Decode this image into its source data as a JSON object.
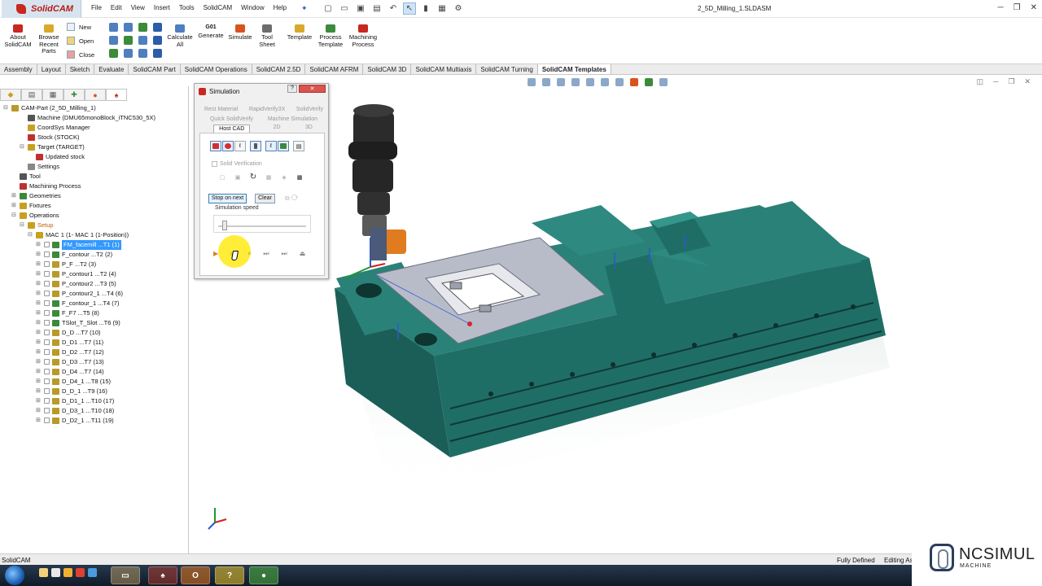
{
  "app": {
    "logo_text": "SolidCAM",
    "document_title": "2_5D_Milling_1.SLDASM"
  },
  "menu": [
    "File",
    "Edit",
    "View",
    "Insert",
    "Tools",
    "SolidCAM",
    "Window",
    "Help"
  ],
  "ribbon": {
    "about": "About\nSolidCAM",
    "browse": "Browse\nRecent\nParts",
    "new": "New",
    "open": "Open",
    "close": "Close",
    "calculate": "Calculate\nAll",
    "generate_code": "G01",
    "generate": "Generate",
    "simulate": "Simulate",
    "tool_sheet": "Tool\nSheet",
    "template": "Template",
    "process_template": "Process\nTemplate",
    "machining_process": "Machining\nProcess"
  },
  "tabs": [
    "Assembly",
    "Layout",
    "Sketch",
    "Evaluate",
    "SolidCAM Part",
    "SolidCAM Operations",
    "SolidCAM 2.5D",
    "SolidCAM AFRM",
    "SolidCAM 3D",
    "SolidCAM Multiaxis",
    "SolidCAM Turning",
    "SolidCAM Templates"
  ],
  "active_tab": "SolidCAM Templates",
  "tree": [
    {
      "label": "CAM-Part (2_5D_Milling_1)",
      "indent": 0,
      "twisty": "⊟",
      "icon": "#b89a2a"
    },
    {
      "label": "Machine (DMU65monoBlock_iTNC530_5X)",
      "indent": 2,
      "twisty": "",
      "icon": "#555"
    },
    {
      "label": "CoordSys Manager",
      "indent": 2,
      "twisty": "",
      "icon": "#c8a020"
    },
    {
      "label": "Stock (STOCK)",
      "indent": 2,
      "twisty": "",
      "icon": "#c03030"
    },
    {
      "label": "Target (TARGET)",
      "indent": 2,
      "twisty": "⊟",
      "icon": "#c8a020"
    },
    {
      "label": "Updated stock",
      "indent": 3,
      "twisty": "",
      "icon": "#c03030"
    },
    {
      "label": "Settings",
      "indent": 2,
      "twisty": "",
      "icon": "#888"
    },
    {
      "label": "Tool",
      "indent": 1,
      "twisty": "",
      "icon": "#555"
    },
    {
      "label": "Machining Process",
      "indent": 1,
      "twisty": "",
      "icon": "#c03030"
    },
    {
      "label": "Geometries",
      "indent": 1,
      "twisty": "⊞",
      "icon": "#3a8a3a"
    },
    {
      "label": "Fixtures",
      "indent": 1,
      "twisty": "⊞",
      "icon": "#c8a020"
    },
    {
      "label": "Operations",
      "indent": 1,
      "twisty": "⊟",
      "icon": "#c8a020"
    },
    {
      "label": "Setup",
      "indent": 2,
      "twisty": "⊟",
      "icon": "#c8a020",
      "orange": true
    },
    {
      "label": "MAC 1 (1- MAC 1 (1-Position))",
      "indent": 3,
      "twisty": "⊟",
      "icon": "#c8a020"
    },
    {
      "label": "FM_facemill ...T1 (1)",
      "indent": 4,
      "twisty": "⊞",
      "icon": "#3a8a3a",
      "selected": true
    },
    {
      "label": "F_contour ...T2 (2)",
      "indent": 4,
      "twisty": "⊞",
      "icon": "#3a8a3a"
    },
    {
      "label": "P_F ...T2 (3)",
      "indent": 4,
      "twisty": "⊞",
      "icon": "#b89a2a"
    },
    {
      "label": "P_contour1 ...T2 (4)",
      "indent": 4,
      "twisty": "⊞",
      "icon": "#b89a2a"
    },
    {
      "label": "P_contour2 ...T3 (5)",
      "indent": 4,
      "twisty": "⊞",
      "icon": "#b89a2a"
    },
    {
      "label": "P_contour2_1 ...T4 (6)",
      "indent": 4,
      "twisty": "⊞",
      "icon": "#b89a2a"
    },
    {
      "label": "F_contour_1 ...T4 (7)",
      "indent": 4,
      "twisty": "⊞",
      "icon": "#3a8a3a"
    },
    {
      "label": "F_F7 ...T5 (8)",
      "indent": 4,
      "twisty": "⊞",
      "icon": "#3a8a3a"
    },
    {
      "label": "TSlot_T_Slot ...T6 (9)",
      "indent": 4,
      "twisty": "⊞",
      "icon": "#3a8a3a"
    },
    {
      "label": "D_D ...T7 (10)",
      "indent": 4,
      "twisty": "⊞",
      "icon": "#b89a2a"
    },
    {
      "label": "D_D1 ...T7 (11)",
      "indent": 4,
      "twisty": "⊞",
      "icon": "#b89a2a"
    },
    {
      "label": "D_D2 ...T7 (12)",
      "indent": 4,
      "twisty": "⊞",
      "icon": "#b89a2a"
    },
    {
      "label": "D_D3 ...T7 (13)",
      "indent": 4,
      "twisty": "⊞",
      "icon": "#b89a2a"
    },
    {
      "label": "D_D4 ...T7 (14)",
      "indent": 4,
      "twisty": "⊞",
      "icon": "#b89a2a"
    },
    {
      "label": "D_D4_1 ...T8 (15)",
      "indent": 4,
      "twisty": "⊞",
      "icon": "#b89a2a"
    },
    {
      "label": "D_D_1 ...T9 (16)",
      "indent": 4,
      "twisty": "⊞",
      "icon": "#b89a2a"
    },
    {
      "label": "D_D1_1 ...T10 (17)",
      "indent": 4,
      "twisty": "⊞",
      "icon": "#b89a2a"
    },
    {
      "label": "D_D3_1 ...T10 (18)",
      "indent": 4,
      "twisty": "⊞",
      "icon": "#b89a2a"
    },
    {
      "label": "D_D2_1 ...T11 (19)",
      "indent": 4,
      "twisty": "⊞",
      "icon": "#b89a2a"
    }
  ],
  "simulation": {
    "title": "Simulation",
    "help": "?",
    "tabs_row1": [
      "Rest Material",
      "RapidVerify3X",
      "SolidVerify"
    ],
    "tabs_row2": [
      "Quick SolidVerify",
      "Machine Simulation"
    ],
    "tabs_row3": [
      "Host CAD",
      "2D",
      "3D"
    ],
    "solid_verification": "Solid Verification",
    "stop_on_next": "Stop on next",
    "clear": "Clear",
    "speed_label": "Simulation speed",
    "speed_value": 0.05
  },
  "status": {
    "left": "SolidCAM",
    "mid": "Fully Defined",
    "right": "Editing As"
  },
  "watermark": {
    "brand": "NCSIMUL",
    "sub": "MACHINE"
  },
  "colors": {
    "vise": "#1e6a63",
    "plate": "#b8bcc9",
    "spindle": "#222222",
    "tool_tip": "#e07b1f",
    "selection": "#3399ff"
  }
}
